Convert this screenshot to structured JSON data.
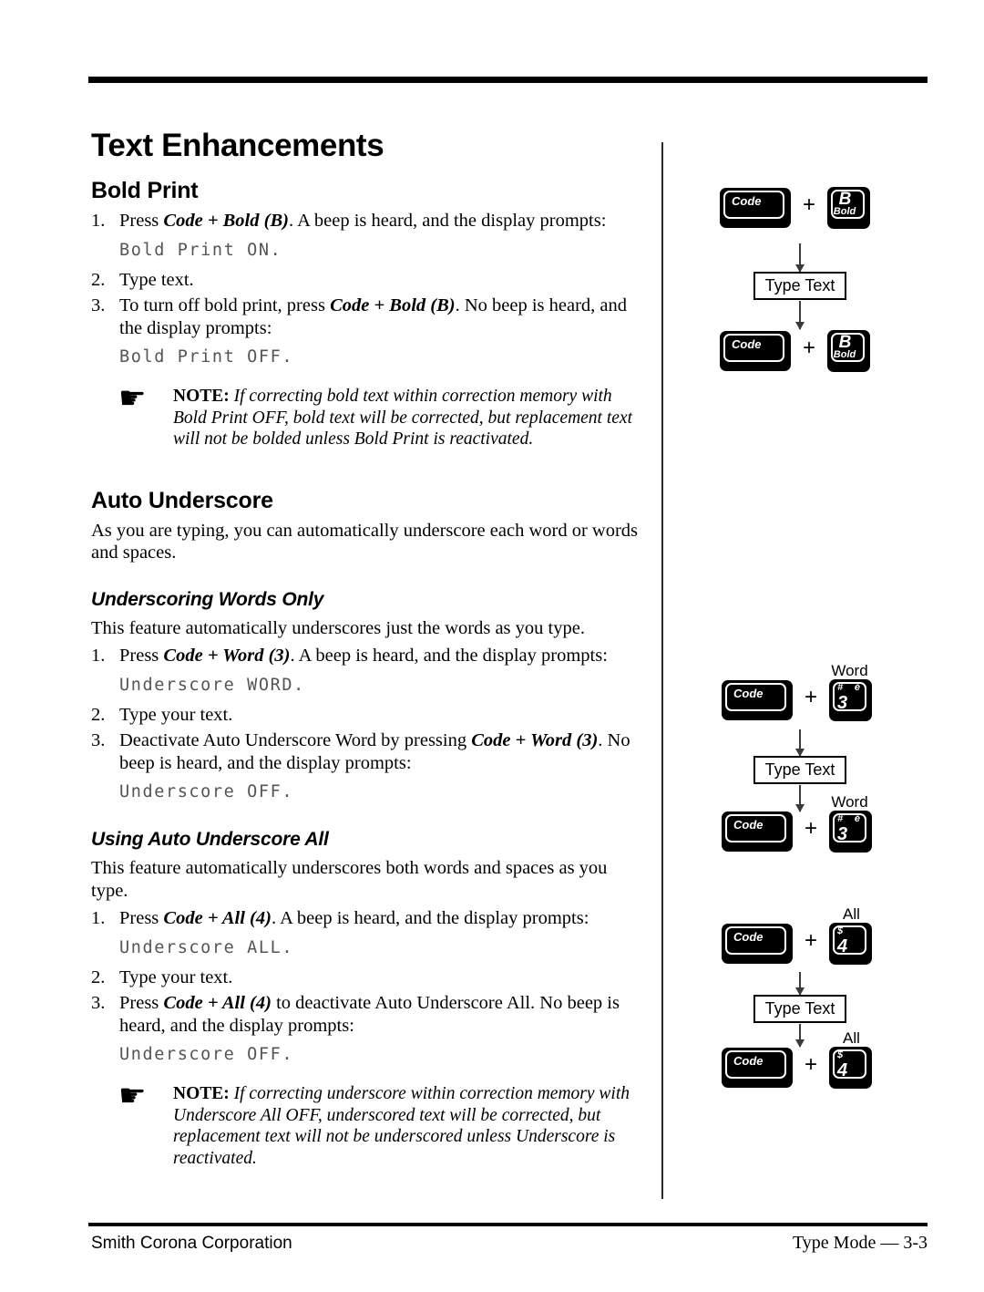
{
  "document": {
    "chapter_title": "Text Enhancements"
  },
  "sections": {
    "bold_print": {
      "heading": "Bold Print",
      "steps": [
        {
          "num": "1.",
          "pre": "Press ",
          "kb": "Code + Bold (B)",
          "post": ". A beep is heard, and the display prompts:"
        },
        {
          "num": "2.",
          "pre": "Type text.",
          "kb": "",
          "post": ""
        },
        {
          "num": "3.",
          "pre": "To turn off bold print, press ",
          "kb": "Code + Bold (B)",
          "post": ". No beep is heard, and the display prompts:"
        }
      ],
      "prompt_on": "Bold Print ON.",
      "prompt_off": "Bold Print OFF.",
      "note_label": "NOTE:",
      "note_text": "If correcting bold text within correction memory with Bold Print OFF, bold text will be corrected, but replacement text will not be bolded unless Bold Print is reactivated."
    },
    "auto_underscore": {
      "heading": "Auto Underscore",
      "intro": "As you are typing, you can automatically underscore each word or words and spaces."
    },
    "underscoring_words_only": {
      "heading": "Underscoring Words Only",
      "intro": "This feature automatically underscores just the words as you type.",
      "steps": [
        {
          "num": "1.",
          "pre": "Press ",
          "kb": "Code + Word (3)",
          "post": ". A beep is heard, and the display prompts:"
        },
        {
          "num": "2.",
          "pre": "Type your text.",
          "kb": "",
          "post": ""
        },
        {
          "num": "3.",
          "pre": "Deactivate Auto Underscore Word by pressing ",
          "kb": "Code + Word (3)",
          "post": ". No beep is heard, and the display prompts:"
        }
      ],
      "prompt_on": "Underscore WORD.",
      "prompt_off": "Underscore OFF."
    },
    "using_auto_underscore_all": {
      "heading": "Using Auto Underscore All",
      "intro": "This feature automatically underscores both words and spaces as you type.",
      "steps": [
        {
          "num": "1.",
          "pre": "Press ",
          "kb": "Code + All (4)",
          "post": ". A beep is heard, and the display prompts:"
        },
        {
          "num": "2.",
          "pre": "Type your text.",
          "kb": "",
          "post": ""
        },
        {
          "num": "3.",
          "pre": "Press ",
          "kb": "Code + All (4)",
          "post": " to deactivate Auto Underscore All. No beep is heard, and the display prompts:"
        }
      ],
      "prompt_on": "Underscore ALL.",
      "prompt_off": "Underscore OFF.",
      "note_label": "NOTE:",
      "note_text": "If correcting underscore within correction memory with Underscore All OFF, underscored text will be corrected, but replacement text will not be underscored unless Underscore is reactivated."
    }
  },
  "diagrams": {
    "bold": {
      "code_key": "Code",
      "target_key_big": "B",
      "target_key_small": "Bold",
      "plus": "+",
      "type_text": "Type Text"
    },
    "word": {
      "code_key": "Code",
      "top_label": "Word",
      "key_top_left": "#",
      "key_top_right": "é",
      "key_num": "3",
      "plus": "+",
      "type_text": "Type Text"
    },
    "all": {
      "code_key": "Code",
      "top_label": "All",
      "key_top_left": "$",
      "key_top_right": "˙",
      "key_num": "4",
      "plus": "+",
      "type_text": "Type Text"
    }
  },
  "footer": {
    "left": "Smith Corona Corporation",
    "right": "Type Mode — 3-3"
  },
  "icons": {
    "pointing_hand": "☛"
  }
}
